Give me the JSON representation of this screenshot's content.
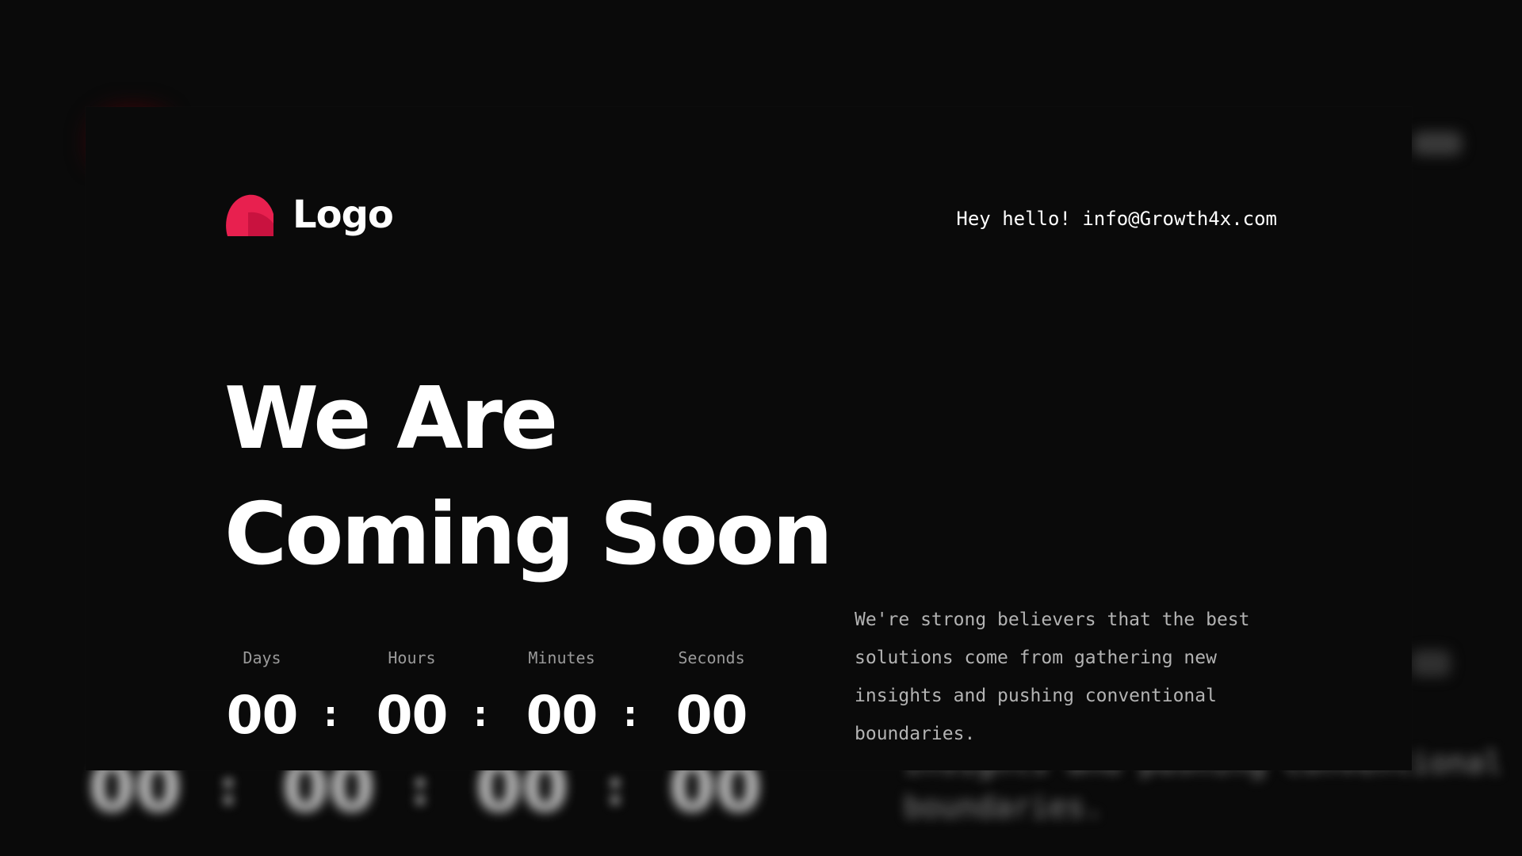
{
  "brand": {
    "logo_text": "Logo",
    "logo_icon": "logo-shape-icon",
    "accent_color": "#e8204f"
  },
  "header": {
    "contact_prefix": "Hey hello!",
    "contact_email": "info@Growth4x.com"
  },
  "hero": {
    "headline_line1": "We Are",
    "headline_line2": "Coming Soon"
  },
  "countdown": {
    "days_label": "Days",
    "days_value": "00",
    "hours_label": "Hours",
    "hours_value": "00",
    "minutes_label": "Minutes",
    "minutes_value": "00",
    "seconds_label": "Seconds",
    "seconds_value": "00",
    "separator": ":"
  },
  "description": "We're strong believers that the best solutions come from gathering new insights and pushing conventional boundaries.",
  "colors": {
    "background": "#0a0a0a",
    "text": "#ffffff",
    "muted_text": "#b3b3b3"
  }
}
